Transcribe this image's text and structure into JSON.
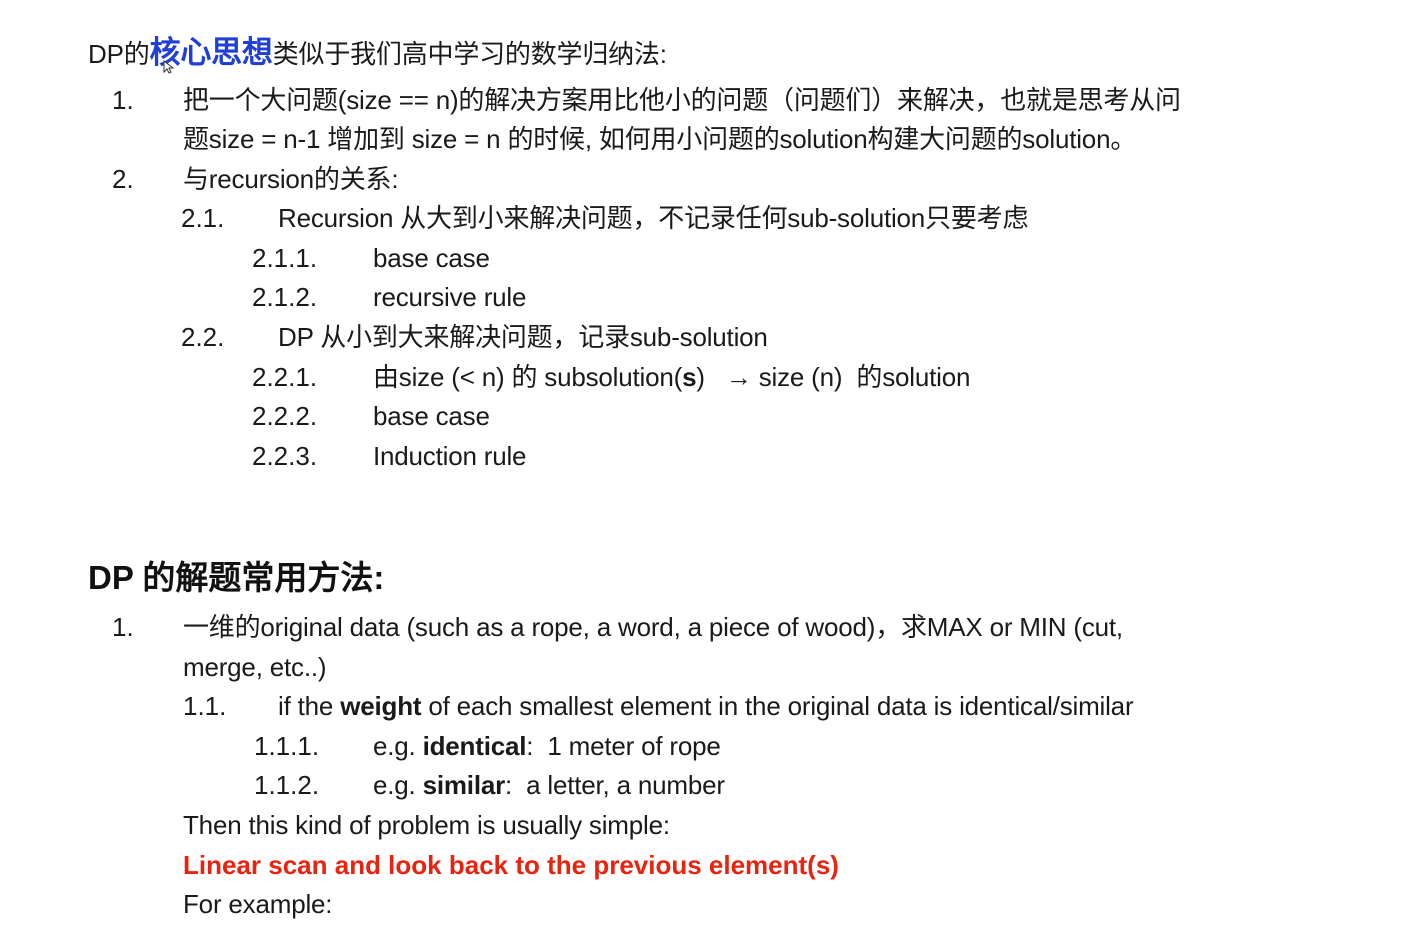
{
  "intro": {
    "prefix": "DP的",
    "highlight": "核心思想",
    "suffix": "类似于我们高中学习的数学归纳法:",
    "highlight_color": "#1f3fd6"
  },
  "list1": [
    {
      "num": "1.",
      "line1": "把一个大问题(size == n)的解决方案用比他小的问题（问题们）来解决，也就是思考从问",
      "line2": "题size = n-1 增加到 size = n 的时候, 如何用小问题的solution构建大问题的solution。"
    },
    {
      "num": "2.",
      "text": "与recursion的关系:",
      "sub": [
        {
          "num": "2.1.",
          "text": "Recursion 从大到小来解决问题，不记录任何sub-solution只要考虑",
          "sub": [
            {
              "num": "2.1.1.",
              "text": "base case"
            },
            {
              "num": "2.1.2.",
              "text": "recursive rule"
            }
          ]
        },
        {
          "num": "2.2.",
          "text": "DP 从小到大来解决问题，记录sub-solution",
          "sub": [
            {
              "num": "2.2.1.",
              "text_a": "由size (< n) 的 subsolution(",
              "text_bold": "s",
              "text_b": ")   → size (n)  的solution"
            },
            {
              "num": "2.2.2.",
              "text": "base case"
            },
            {
              "num": "2.2.3.",
              "text": "Induction rule"
            }
          ]
        }
      ]
    }
  ],
  "section2": {
    "heading": "DP 的解题常用方法:",
    "item1": {
      "num": "1.",
      "line1": "一维的original data (such as a rope, a word, a piece of wood)，求MAX or MIN (cut,",
      "line2": "merge, etc..)",
      "sub": {
        "num": "1.1.",
        "text_a": "if the ",
        "text_bold": "weight",
        "text_b": " of each smallest element in the original data is identical/similar",
        "sub": [
          {
            "num": "1.1.1.",
            "text_a": "e.g. ",
            "text_bold": "identical",
            "text_b": ":  1 meter of rope"
          },
          {
            "num": "1.1.2.",
            "text_a": "e.g. ",
            "text_bold": "similar",
            "text_b": ":  a letter, a number"
          }
        ]
      },
      "then_text": "Then this kind of problem is usually simple:",
      "highlight_text": "Linear scan and look back to the previous element(s)",
      "highlight_color": "#e8230f",
      "example_text": "For example:"
    }
  }
}
